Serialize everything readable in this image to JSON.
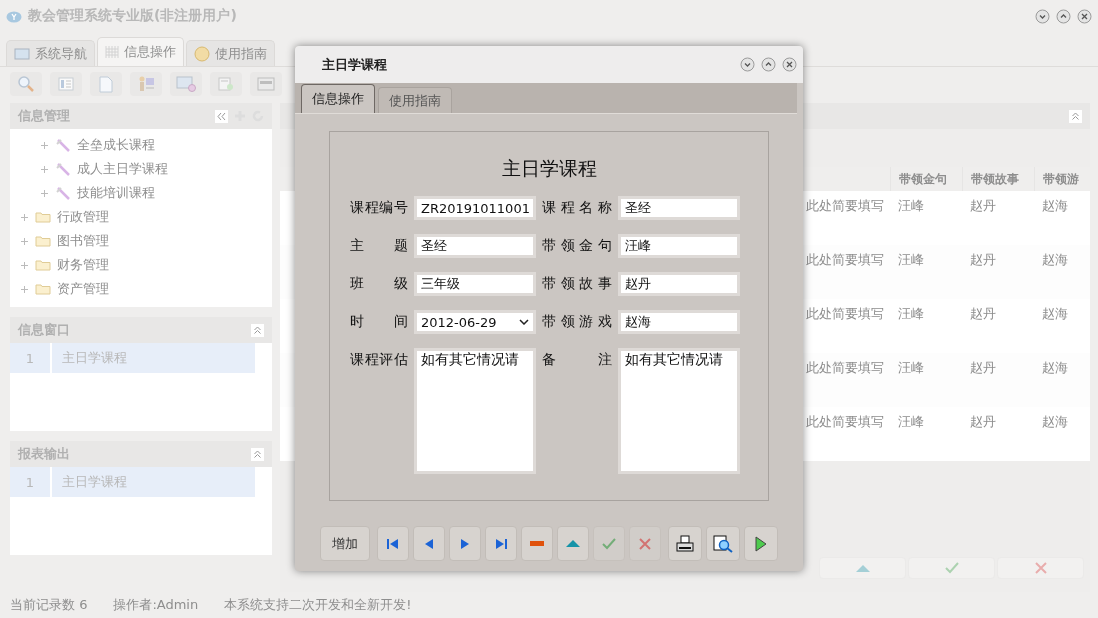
{
  "app": {
    "title": "教会管理系统专业版(非注册用户)"
  },
  "main_tabs": [
    {
      "label": "系统导航",
      "selected": false
    },
    {
      "label": "信息操作",
      "selected": true
    },
    {
      "label": "使用指南",
      "selected": false
    }
  ],
  "info_panel": {
    "title": "信息管理",
    "tree": {
      "continued_children": [
        {
          "label": "全垒成长课程",
          "expanded": false
        },
        {
          "label": "成人主日学课程",
          "expanded": false
        },
        {
          "label": "技能培训课程",
          "expanded": false
        }
      ],
      "items": [
        {
          "label": "行政管理",
          "expanded": false
        },
        {
          "label": "图书管理",
          "expanded": false
        },
        {
          "label": "财务管理",
          "expanded": false
        },
        {
          "label": "资产管理",
          "expanded": false
        }
      ]
    }
  },
  "window_panel": {
    "title": "信息窗口",
    "rows": [
      {
        "number": "1",
        "label": "主日学课程",
        "selected": true
      }
    ]
  },
  "report_panel": {
    "title": "报表输出",
    "rows": [
      {
        "number": "1",
        "label": "主日学课程",
        "selected": true
      }
    ]
  },
  "grid": {
    "columns": [
      "",
      "带领金句",
      "带领故事",
      "带领游"
    ],
    "rows": [
      [
        "此处简要填写",
        "汪峰",
        "赵丹",
        "赵海"
      ],
      [
        "此处简要填写",
        "汪峰",
        "赵丹",
        "赵海"
      ],
      [
        "此处简要填写",
        "汪峰",
        "赵丹",
        "赵海"
      ],
      [
        "此处简要填写",
        "汪峰",
        "赵丹",
        "赵海"
      ],
      [
        "此处简要填写",
        "汪峰",
        "赵丹",
        "赵海"
      ]
    ],
    "buttons": [
      {
        "kind": "up"
      },
      {
        "kind": "check"
      },
      {
        "kind": "close"
      }
    ]
  },
  "status_bar": [
    "当前记录数 6",
    "操作者:Admin",
    "本系统支持二次开发和全新开发!"
  ],
  "dialog": {
    "title": "主日学课程",
    "tabs": [
      {
        "label": "信息操作",
        "selected": true
      },
      {
        "label": "使用指南",
        "selected": false
      }
    ],
    "form": {
      "heading": "主日学课程",
      "fields": [
        {
          "label": "课程编号",
          "value": "ZR20191011001",
          "kind": "text"
        },
        {
          "label": "课程名称",
          "value": "圣经",
          "kind": "text"
        },
        {
          "label": "主 题",
          "value": "圣经",
          "kind": "text"
        },
        {
          "label": "带领金句",
          "value": "汪峰",
          "kind": "text"
        },
        {
          "label": "班 级",
          "value": "三年级",
          "kind": "text"
        },
        {
          "label": "带领故事",
          "value": "赵丹",
          "kind": "text"
        },
        {
          "label": "时 间",
          "value": "2012-06-29",
          "kind": "date"
        },
        {
          "label": "带领游戏",
          "value": "赵海",
          "kind": "text"
        },
        {
          "label": "课程评估",
          "value": "如有其它情况请",
          "kind": "memo"
        },
        {
          "label": "备 注",
          "value": "如有其它情况请",
          "kind": "memo"
        }
      ]
    },
    "buttons": [
      {
        "kind": "text",
        "label": "增加",
        "disabled": false
      },
      {
        "kind": "first",
        "disabled": false
      },
      {
        "kind": "prev",
        "disabled": false
      },
      {
        "kind": "next",
        "disabled": false
      },
      {
        "kind": "last",
        "disabled": false
      },
      {
        "kind": "delete",
        "disabled": false
      },
      {
        "kind": "up",
        "disabled": false
      },
      {
        "kind": "check",
        "disabled": true
      },
      {
        "kind": "close",
        "disabled": true
      },
      {
        "kind": "print",
        "disabled": false
      },
      {
        "kind": "preview",
        "disabled": false
      },
      {
        "kind": "run",
        "disabled": false
      }
    ]
  }
}
